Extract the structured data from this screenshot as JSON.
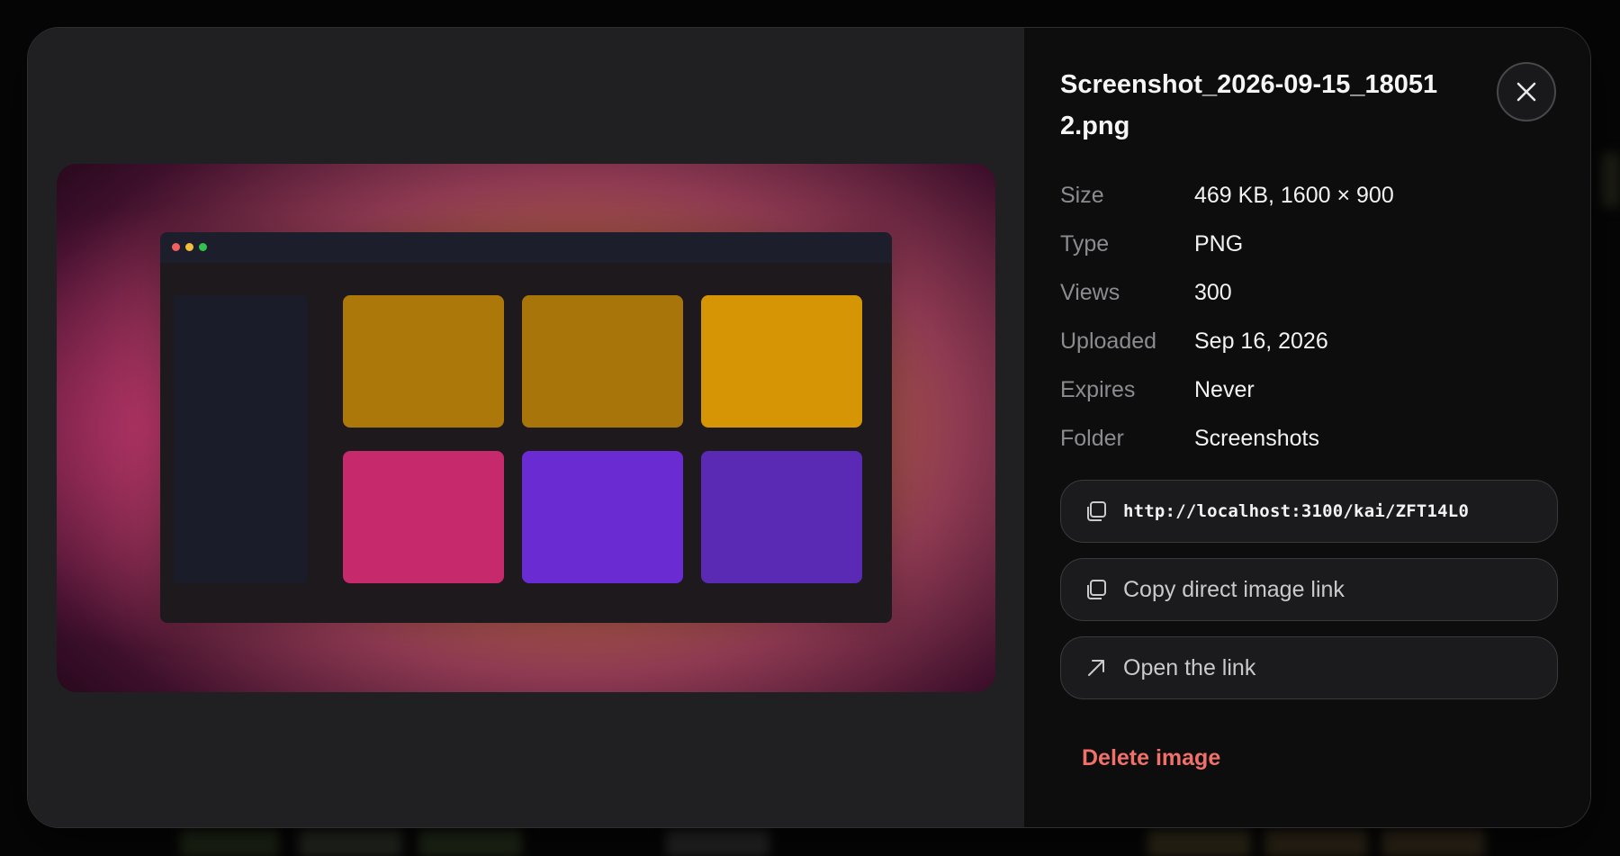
{
  "file": {
    "name": "Screenshot_2026-09-15_180512.png"
  },
  "meta": [
    {
      "key": "Size",
      "value": "469 KB, 1600 × 900"
    },
    {
      "key": "Type",
      "value": "PNG"
    },
    {
      "key": "Views",
      "value": "300"
    },
    {
      "key": "Uploaded",
      "value": "Sep 16, 2026"
    },
    {
      "key": "Expires",
      "value": "Never"
    },
    {
      "key": "Folder",
      "value": "Screenshots"
    }
  ],
  "actions": {
    "share_url": "http://localhost:3100/kai/ZFT14L0",
    "copy_direct_label": "Copy direct image link",
    "open_link_label": "Open the link"
  },
  "delete_label": "Delete image",
  "icons": {
    "close": "close-icon",
    "copy": "copy-icon",
    "open": "arrow-up-right-icon"
  },
  "colors": {
    "accent_delete": "#f0706a",
    "card_amber_1": "#ad780a",
    "card_amber_2": "#a8750b",
    "card_amber_3": "#d59504",
    "card_pink": "#c72a6c",
    "card_violet_1": "#6a2bd3",
    "card_violet_2": "#5a2ab4",
    "traffic_red": "#f25f5f",
    "traffic_yellow": "#f2bd3a",
    "traffic_green": "#33c24d"
  }
}
